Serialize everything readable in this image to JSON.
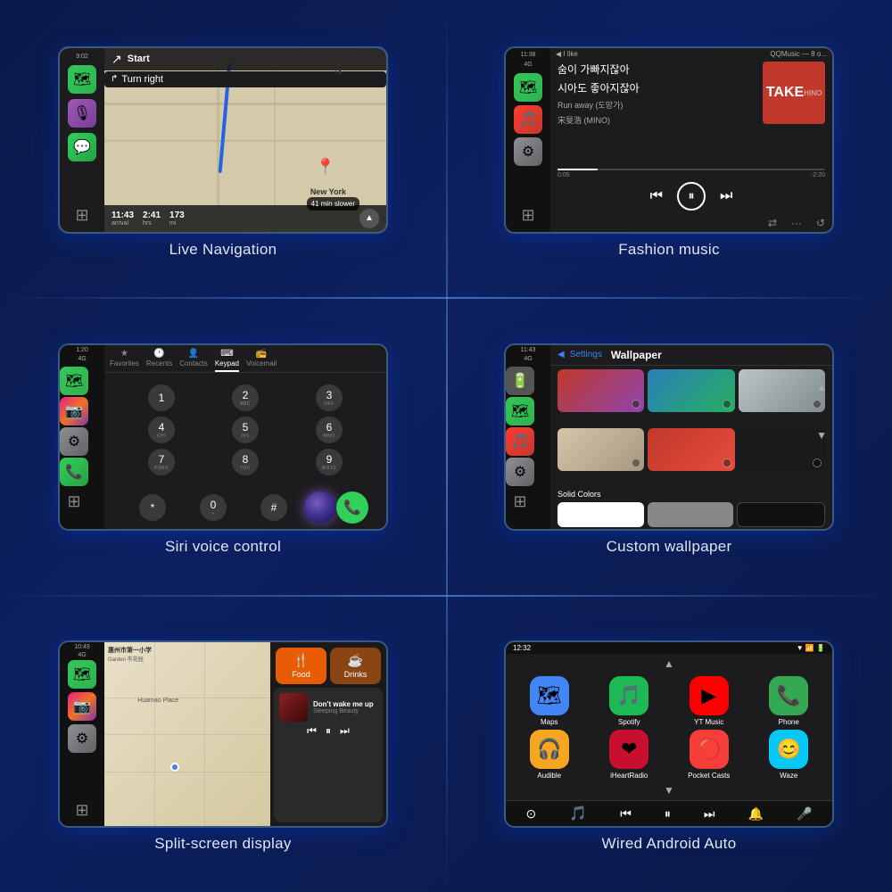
{
  "cells": [
    {
      "id": "live-navigation",
      "label": "Live Navigation",
      "screen": {
        "time": "9:02",
        "instruction": "Turn right",
        "start": "Start",
        "arrival": "11:43",
        "hrs": "2:41",
        "mi": "173",
        "destination": "New York",
        "eta_slower": "41 min slower"
      }
    },
    {
      "id": "fashion-music",
      "label": "Fashion music",
      "screen": {
        "time": "11:38",
        "signal": "4G",
        "song_title": "I like",
        "app": "QQMusic — 8 o...",
        "lyric1": "숨이 가빠지잖아",
        "lyric2": "시아도 좋아지잖아",
        "track": "Run away (도망가)",
        "artist": "宋旻浩 (MINO)",
        "album_text": "TAKE",
        "time_current": "0:05",
        "time_remaining": "-2:20"
      }
    },
    {
      "id": "siri-voice-control",
      "label": "Siri voice control",
      "screen": {
        "time": "1:20",
        "tabs": [
          "Favorites",
          "Recents",
          "Contacts",
          "Keypad",
          "Voicemail"
        ],
        "active_tab": "Keypad",
        "dialpad": [
          "1",
          "2",
          "3",
          "4",
          "5",
          "6",
          "7",
          "8",
          "9",
          "*",
          "0",
          "#"
        ],
        "sub": [
          "",
          "ABC",
          "DEF",
          "GHI",
          "JKL",
          "MNO",
          "PQRS",
          "TUV",
          "WXYZ",
          "",
          "+",
          ""
        ]
      }
    },
    {
      "id": "custom-wallpaper",
      "label": "Custom wallpaper",
      "screen": {
        "time": "11:43",
        "back_label": "Settings",
        "title": "Wallpaper",
        "section": "Solid Colors"
      }
    },
    {
      "id": "split-screen-display",
      "label": "Split-screen display",
      "screen": {
        "time": "10:49",
        "signal": "4G",
        "food_label": "Food",
        "drinks_label": "Drinks",
        "song_title": "Don't wake me up",
        "song_artist": "Sleeping Beauty"
      }
    },
    {
      "id": "wired-android-auto",
      "label": "Wired Android Auto",
      "screen": {
        "time": "12:32",
        "apps": [
          {
            "name": "Maps",
            "icon": "🗺",
            "bg": "#4285F4"
          },
          {
            "name": "Spotify",
            "icon": "🎵",
            "bg": "#1DB954"
          },
          {
            "name": "YT Music",
            "icon": "▶",
            "bg": "#FF0000"
          },
          {
            "name": "Phone",
            "icon": "📞",
            "bg": "#34A853"
          },
          {
            "name": "Audible",
            "icon": "🎧",
            "bg": "#F5A623"
          },
          {
            "name": "iHeartRadio",
            "icon": "❤",
            "bg": "#C8102E"
          },
          {
            "name": "Pocket Casts",
            "icon": "🔴",
            "bg": "#F43E37"
          },
          {
            "name": "Waze",
            "icon": "😊",
            "bg": "#05C8F7"
          }
        ]
      }
    }
  ]
}
